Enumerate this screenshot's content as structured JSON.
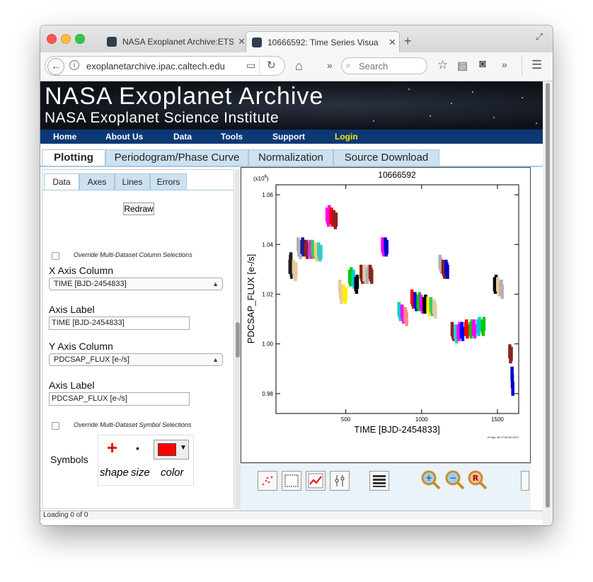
{
  "browser": {
    "tabs": [
      {
        "label": "NASA Exoplanet Archive:ETS",
        "active": false
      },
      {
        "label": "10666592: Time Series Visua",
        "active": true
      }
    ],
    "new_tab_label": "+",
    "url": "exoplanetarchive.ipac.caltech.edu",
    "search_placeholder": "Search"
  },
  "banner": {
    "title": "NASA Exoplanet Archive",
    "subtitle": "NASA Exoplanet Science Institute"
  },
  "menu": [
    "Home",
    "About Us",
    "Data",
    "Tools",
    "Support",
    "Login"
  ],
  "colors": {
    "menu_bg": "#0c3875",
    "login": "#f5e800",
    "accent_tab": "#cde1ef"
  },
  "main_tabs": [
    "Plotting",
    "Periodogram/Phase Curve",
    "Normalization",
    "Source Download"
  ],
  "sub_tabs": [
    "Data",
    "Axes",
    "Lines",
    "Errors"
  ],
  "left_panel": {
    "redraw_label": "Redraw",
    "override_columns_label": "Override Multi-Dataset Column Selections",
    "x_axis_column_label": "X Axis Column",
    "x_axis_column_value": "TIME [BJD-2454833]",
    "x_axis_label_label": "Axis Label",
    "x_axis_label_value": "TIME [BJD-2454833]",
    "y_axis_column_label": "Y Axis Column",
    "y_axis_column_value": "PDCSAP_FLUX [e-/s]",
    "y_axis_label_label": "Axis Label",
    "y_axis_label_value": "PDCSAP_FLUX [e-/s]",
    "override_symbols_label": "Override Multi-Dataset Symbol Selections",
    "symbols_label": "Symbols",
    "shape_label": "shape",
    "size_label": "size",
    "color_label": "color",
    "symbol_shape": "+",
    "symbol_size": "•",
    "symbol_color": "#ff0000"
  },
  "status_text": "Loading 0 of 0",
  "chart_data": {
    "type": "scatter",
    "title": "10666592",
    "xlabel": "TIME [BJD-2454833]",
    "ylabel": "PDCSAP_FLUX [e-/s]",
    "y_multiplier_label": "(x10",
    "y_multiplier_exp": "6",
    "xlim": [
      40,
      1640
    ],
    "ylim": [
      0.972,
      1.064
    ],
    "x_ticks": [
      500,
      1000,
      1500
    ],
    "y_ticks": [
      "0.98",
      "1.00",
      "1.02",
      "1.04",
      "1.06"
    ],
    "y_tick_values": [
      0.98,
      1.0,
      1.02,
      1.04,
      1.06
    ],
    "footer": "Fri Apr 28 17:03:40 2017",
    "series": [
      {
        "color": "#1f1f1f",
        "values": [
          [
            131,
            1.031
          ],
          [
            134,
            1.033
          ],
          [
            137,
            1.034
          ],
          [
            140,
            1.03
          ],
          [
            143,
            1.029
          ],
          [
            146,
            1.031
          ]
        ]
      },
      {
        "color": "#e8c8a0",
        "values": [
          [
            155,
            1.031
          ],
          [
            159,
            1.029
          ],
          [
            163,
            1.03
          ],
          [
            167,
            1.028
          ],
          [
            171,
            1.03
          ]
        ]
      },
      {
        "color": "#b0b0b0",
        "values": [
          [
            185,
            1.04
          ],
          [
            190,
            1.038
          ],
          [
            195,
            1.039
          ],
          [
            200,
            1.037
          ]
        ]
      },
      {
        "color": "#1a1a99",
        "values": [
          [
            210,
            1.039
          ],
          [
            215,
            1.04
          ],
          [
            220,
            1.038
          ],
          [
            225,
            1.039
          ]
        ]
      },
      {
        "color": "#8b2323",
        "values": [
          [
            235,
            1.038
          ],
          [
            240,
            1.039
          ],
          [
            245,
            1.037
          ],
          [
            250,
            1.038
          ]
        ]
      },
      {
        "color": "#dd33dd",
        "values": [
          [
            260,
            1.038
          ],
          [
            265,
            1.039
          ],
          [
            270,
            1.037
          ]
        ]
      },
      {
        "color": "#33cc66",
        "values": [
          [
            280,
            1.039
          ],
          [
            285,
            1.038
          ],
          [
            290,
            1.037
          ]
        ]
      },
      {
        "color": "#ffcc66",
        "values": [
          [
            300,
            1.038
          ],
          [
            305,
            1.037
          ],
          [
            310,
            1.036
          ]
        ]
      },
      {
        "color": "#33cccc",
        "values": [
          [
            320,
            1.038
          ],
          [
            325,
            1.037
          ],
          [
            330,
            1.036
          ],
          [
            335,
            1.037
          ]
        ]
      },
      {
        "color": "#ff00ff",
        "values": [
          [
            375,
            1.052
          ],
          [
            380,
            1.051
          ],
          [
            385,
            1.05
          ],
          [
            390,
            1.053
          ]
        ]
      },
      {
        "color": "#ff0000",
        "values": [
          [
            400,
            1.051
          ],
          [
            405,
            1.052
          ],
          [
            410,
            1.05
          ]
        ]
      },
      {
        "color": "#8b2323",
        "values": [
          [
            420,
            1.051
          ],
          [
            425,
            1.05
          ],
          [
            430,
            1.049
          ],
          [
            435,
            1.05
          ]
        ]
      },
      {
        "color": "#e8c8a0",
        "values": [
          [
            460,
            1.023
          ],
          [
            465,
            1.021
          ],
          [
            470,
            1.019
          ],
          [
            475,
            1.02
          ]
        ]
      },
      {
        "color": "#ffee00",
        "values": [
          [
            485,
            1.021
          ],
          [
            490,
            1.02
          ],
          [
            495,
            1.019
          ],
          [
            500,
            1.02
          ]
        ]
      },
      {
        "color": "#00cc00",
        "values": [
          [
            525,
            1.027
          ],
          [
            530,
            1.026
          ],
          [
            535,
            1.028
          ]
        ]
      },
      {
        "color": "#00cccc",
        "values": [
          [
            545,
            1.026
          ],
          [
            550,
            1.027
          ],
          [
            555,
            1.025
          ]
        ]
      },
      {
        "color": "#000000",
        "values": [
          [
            565,
            1.024
          ],
          [
            570,
            1.023
          ],
          [
            575,
            1.025
          ]
        ]
      },
      {
        "color": "#8b2323",
        "values": [
          [
            600,
            1.029
          ],
          [
            605,
            1.028
          ],
          [
            610,
            1.027
          ]
        ]
      },
      {
        "color": "#e8c8a0",
        "values": [
          [
            620,
            1.028
          ],
          [
            625,
            1.029
          ],
          [
            630,
            1.027
          ]
        ]
      },
      {
        "color": "#b0b0b0",
        "values": [
          [
            640,
            1.027
          ],
          [
            645,
            1.028
          ],
          [
            650,
            1.029
          ]
        ]
      },
      {
        "color": "#8b2323",
        "values": [
          [
            660,
            1.029
          ],
          [
            665,
            1.028
          ],
          [
            670,
            1.027
          ]
        ]
      },
      {
        "color": "#ff00ff",
        "values": [
          [
            740,
            1.04
          ],
          [
            745,
            1.039
          ],
          [
            750,
            1.038
          ]
        ]
      },
      {
        "color": "#0000cc",
        "values": [
          [
            760,
            1.04
          ],
          [
            765,
            1.038
          ],
          [
            770,
            1.039
          ]
        ]
      },
      {
        "color": "#00cccc",
        "values": [
          [
            850,
            1.014
          ],
          [
            855,
            1.013
          ],
          [
            860,
            1.012
          ]
        ]
      },
      {
        "color": "#ff00ff",
        "values": [
          [
            870,
            1.013
          ],
          [
            875,
            1.012
          ],
          [
            880,
            1.011
          ]
        ]
      },
      {
        "color": "#ff8888",
        "values": [
          [
            890,
            1.012
          ],
          [
            895,
            1.011
          ],
          [
            900,
            1.01
          ]
        ]
      },
      {
        "color": "#ff0000",
        "values": [
          [
            935,
            1.019
          ],
          [
            940,
            1.018
          ],
          [
            945,
            1.017
          ]
        ]
      },
      {
        "color": "#0000ff",
        "values": [
          [
            955,
            1.018
          ],
          [
            960,
            1.017
          ],
          [
            965,
            1.016
          ]
        ]
      },
      {
        "color": "#00cc00",
        "values": [
          [
            975,
            1.017
          ],
          [
            980,
            1.016
          ],
          [
            985,
            1.018
          ]
        ]
      },
      {
        "color": "#ff00ff",
        "values": [
          [
            995,
            1.017
          ],
          [
            1000,
            1.016
          ],
          [
            1005,
            1.015
          ]
        ]
      },
      {
        "color": "#000000",
        "values": [
          [
            1015,
            1.016
          ],
          [
            1020,
            1.015
          ],
          [
            1025,
            1.017
          ]
        ]
      },
      {
        "color": "#ffee00",
        "values": [
          [
            1040,
            1.016
          ],
          [
            1045,
            1.015
          ],
          [
            1050,
            1.014
          ]
        ]
      },
      {
        "color": "#33cc66",
        "values": [
          [
            1060,
            1.016
          ],
          [
            1065,
            1.015
          ],
          [
            1070,
            1.014
          ]
        ]
      },
      {
        "color": "#e8c8a0",
        "values": [
          [
            1080,
            1.015
          ],
          [
            1085,
            1.014
          ],
          [
            1090,
            1.013
          ]
        ]
      },
      {
        "color": "#b0b0b0",
        "values": [
          [
            1120,
            1.033
          ],
          [
            1125,
            1.032
          ],
          [
            1130,
            1.031
          ]
        ]
      },
      {
        "color": "#8b2323",
        "values": [
          [
            1140,
            1.031
          ],
          [
            1145,
            1.03
          ],
          [
            1150,
            1.029
          ]
        ]
      },
      {
        "color": "#0000cc",
        "values": [
          [
            1160,
            1.031
          ],
          [
            1165,
            1.03
          ],
          [
            1170,
            1.029
          ]
        ]
      },
      {
        "color": "#8b2323",
        "values": [
          [
            1200,
            1.006
          ],
          [
            1205,
            1.005
          ],
          [
            1210,
            1.004
          ]
        ]
      },
      {
        "color": "#33cccc",
        "values": [
          [
            1220,
            1.005
          ],
          [
            1225,
            1.004
          ],
          [
            1230,
            1.003
          ]
        ]
      },
      {
        "color": "#ff00ff",
        "values": [
          [
            1240,
            1.005
          ],
          [
            1245,
            1.004
          ],
          [
            1250,
            1.006
          ]
        ]
      },
      {
        "color": "#0000ff",
        "values": [
          [
            1260,
            1.005
          ],
          [
            1265,
            1.006
          ],
          [
            1270,
            1.004
          ]
        ]
      },
      {
        "color": "#ff0000",
        "values": [
          [
            1290,
            1.006
          ],
          [
            1295,
            1.007
          ],
          [
            1300,
            1.005
          ]
        ]
      },
      {
        "color": "#00cc00",
        "values": [
          [
            1320,
            1.006
          ],
          [
            1325,
            1.005
          ],
          [
            1330,
            1.007
          ]
        ]
      },
      {
        "color": "#ff00ff",
        "values": [
          [
            1340,
            1.006
          ],
          [
            1345,
            1.007
          ],
          [
            1350,
            1.005
          ]
        ]
      },
      {
        "color": "#00cccc",
        "values": [
          [
            1370,
            1.007
          ],
          [
            1375,
            1.006
          ],
          [
            1380,
            1.008
          ]
        ]
      },
      {
        "color": "#00cc00",
        "values": [
          [
            1400,
            1.007
          ],
          [
            1405,
            1.006
          ],
          [
            1410,
            1.008
          ]
        ]
      },
      {
        "color": "#000000",
        "values": [
          [
            1480,
            1.024
          ],
          [
            1485,
            1.023
          ],
          [
            1490,
            1.025
          ]
        ]
      },
      {
        "color": "#e8c8a0",
        "values": [
          [
            1500,
            1.024
          ],
          [
            1505,
            1.023
          ],
          [
            1510,
            1.022
          ]
        ]
      },
      {
        "color": "#b0b0b0",
        "values": [
          [
            1520,
            1.022
          ],
          [
            1525,
            1.023
          ],
          [
            1530,
            1.021
          ]
        ]
      },
      {
        "color": "#8b2323",
        "values": [
          [
            1580,
            0.997
          ],
          [
            1585,
            0.995
          ],
          [
            1590,
            0.996
          ]
        ]
      },
      {
        "color": "#0000cc",
        "values": [
          [
            1595,
            0.988
          ],
          [
            1597,
            0.985
          ],
          [
            1600,
            0.982
          ]
        ]
      }
    ]
  },
  "toolbar": {
    "tools": [
      "scatter-tool-icon",
      "select-box-icon",
      "line-plot-icon",
      "error-bars-icon",
      "stack-icon"
    ],
    "zoom": [
      "zoom-in-icon",
      "zoom-out-icon",
      "zoom-reset-icon"
    ],
    "zoom_letters": [
      "+",
      "−",
      "R"
    ]
  }
}
